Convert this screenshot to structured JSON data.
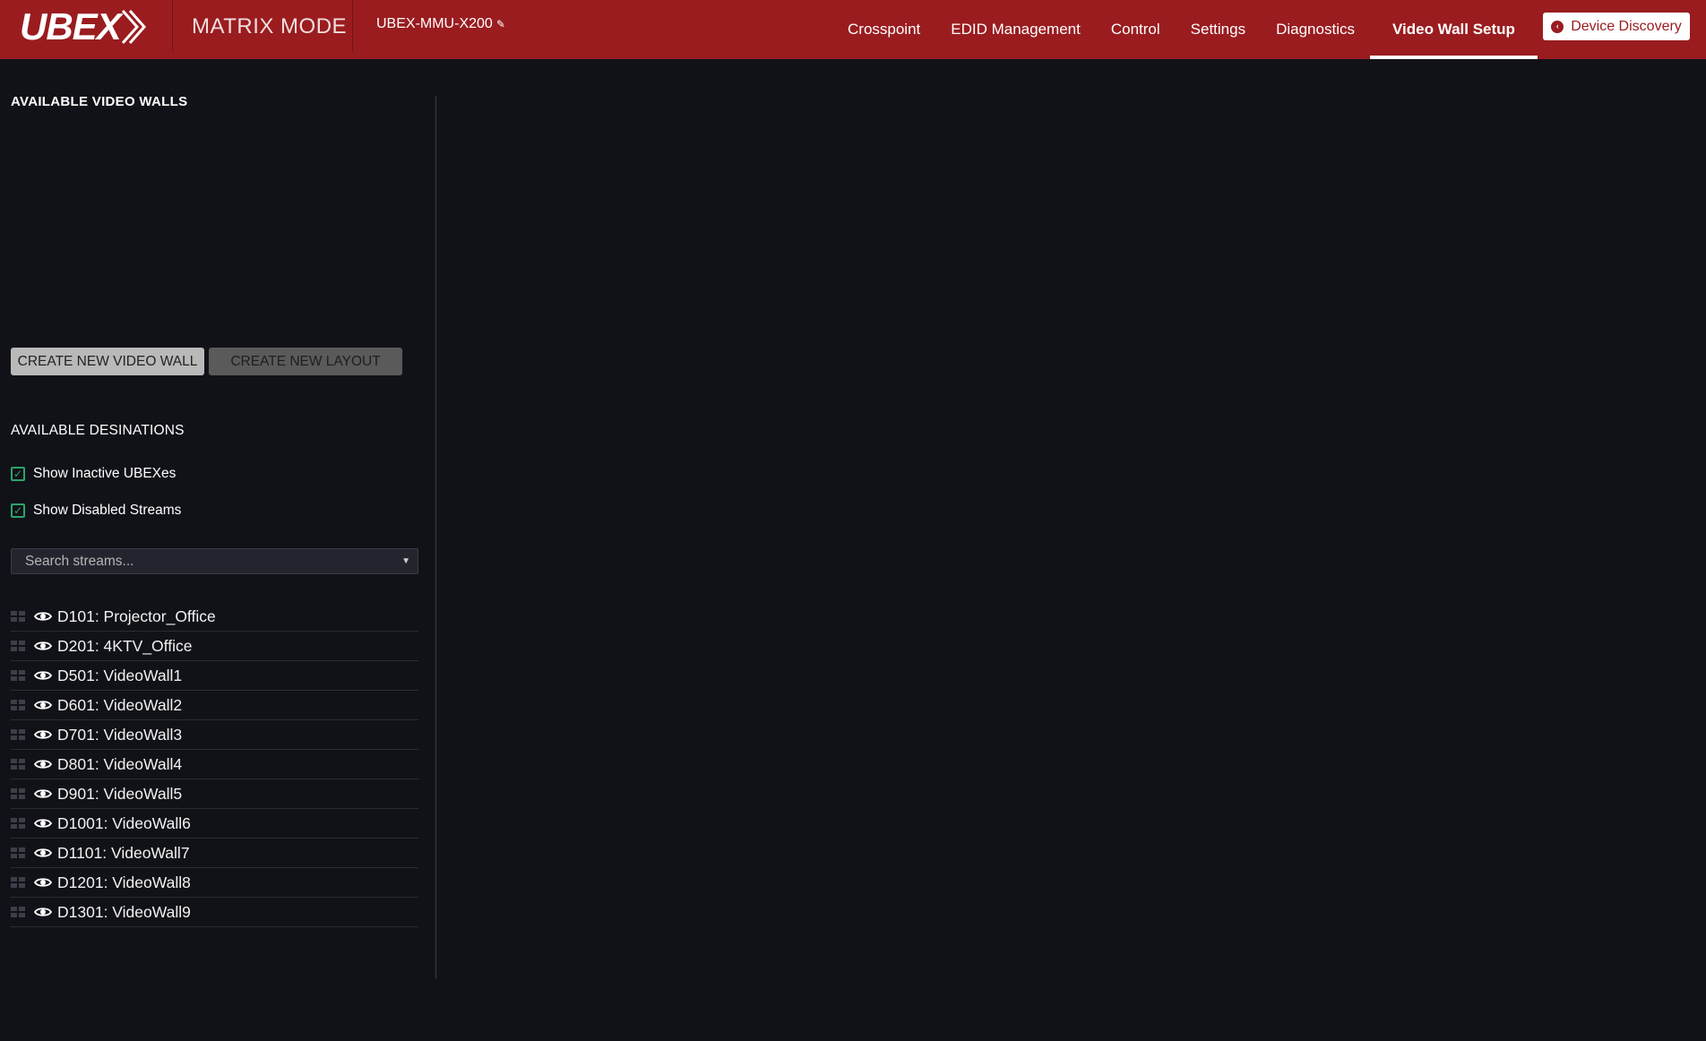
{
  "header": {
    "logo": "UBEX",
    "mode": "MATRIX MODE",
    "device_name": "UBEX-MMU-X200",
    "nav": [
      {
        "label": "Crosspoint"
      },
      {
        "label": "EDID Management"
      },
      {
        "label": "Control"
      },
      {
        "label": "Settings"
      },
      {
        "label": "Diagnostics"
      },
      {
        "label": "Video Wall Setup"
      }
    ],
    "discovery_label": "Device Discovery"
  },
  "video_walls": {
    "title": "AVAILABLE VIDEO WALLS",
    "create_wall_label": "CREATE NEW VIDEO WALL",
    "create_layout_label": "CREATE NEW LAYOUT"
  },
  "destinations": {
    "title": "AVAILABLE DESINATIONS",
    "show_inactive_label": "Show Inactive UBEXes",
    "show_disabled_label": "Show Disabled Streams",
    "search_placeholder": "Search streams...",
    "streams": [
      {
        "label": "D101: Projector_Office"
      },
      {
        "label": "D201: 4KTV_Office"
      },
      {
        "label": "D501: VideoWall1"
      },
      {
        "label": "D601: VideoWall2"
      },
      {
        "label": "D701: VideoWall3"
      },
      {
        "label": "D801: VideoWall4"
      },
      {
        "label": "D901: VideoWall5"
      },
      {
        "label": "D1001: VideoWall6"
      },
      {
        "label": "D1101: VideoWall7"
      },
      {
        "label": "D1201: VideoWall8"
      },
      {
        "label": "D1301: VideoWall9"
      }
    ]
  },
  "colors": {
    "header_bg": "#9a1c1f",
    "page_bg": "#111218",
    "check_accent": "#2ea36b"
  },
  "icons": {
    "stream_handle": "drag-grip-icon",
    "stream_visibility": "eye-icon",
    "discovery": "chevron-left-circle-icon",
    "edit": "pencil-icon",
    "search_caret": "caret-down-icon"
  }
}
